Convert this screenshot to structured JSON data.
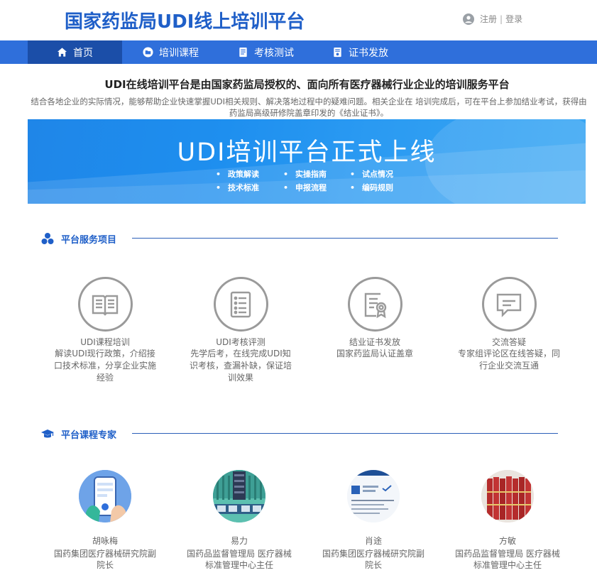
{
  "header": {
    "site_title": "国家药监局UDI线上培训平台",
    "register": "注册",
    "separator": "|",
    "login": "登录"
  },
  "nav": {
    "items": [
      {
        "label": "首页",
        "icon": "home-icon"
      },
      {
        "label": "培训课程",
        "icon": "folder-icon"
      },
      {
        "label": "考核测试",
        "icon": "document-icon"
      },
      {
        "label": "证书发放",
        "icon": "certificate-icon"
      }
    ]
  },
  "intro": {
    "title": "UDI在线培训平台是由国家药监局授权的、面向所有医疗器械行业企业的培训服务平台",
    "desc": "结合各地企业的实际情况，能够帮助企业快速掌握UDI相关规则、解决落地过程中的疑难问题。相关企业在 培训完成后，可在平台上参加结业考试，获得由药监局高级研修院盖章印发的《结业证书》。"
  },
  "banner": {
    "title": "UDI培训平台正式上线",
    "points": [
      "政策解读",
      "实操指南",
      "试点情况",
      "技术标准",
      "申报流程",
      "编码规则"
    ]
  },
  "services_section": {
    "title": "平台服务项目",
    "items": [
      {
        "name": "UDI课程培训",
        "desc": "解读UDI现行政策，介绍接口技术标准，分享企业实施经验",
        "icon": "open-book-icon"
      },
      {
        "name": "UDI考核评测",
        "desc": "先学后考，在线完成UDI知识考核，查漏补缺，保证培训效果",
        "icon": "checklist-icon"
      },
      {
        "name": "结业证书发放",
        "desc": "国家药监局认证盖章",
        "icon": "certificate-badge-icon"
      },
      {
        "name": "交流答疑",
        "desc": "专家组评论区在线答疑，同行企业交流互通",
        "icon": "chat-bubble-icon"
      }
    ]
  },
  "experts_section": {
    "title": "平台课程专家",
    "items": [
      {
        "name": "胡咏梅",
        "title": "国药集团医疗器械研究院副院长"
      },
      {
        "name": "易力",
        "title": "国药品监督管理局 医疗器械标准管理中心主任"
      },
      {
        "name": "肖途",
        "title": "国药集团医疗器械研究院副院长"
      },
      {
        "name": "方敏",
        "title": "国药品监督管理局 医疗器械标准管理中心主任"
      }
    ]
  },
  "colors": {
    "brand_blue": "#1f5fc8",
    "nav_blue": "#2f6fdb",
    "nav_active": "#1b4ea8",
    "banner_blue": "#1f86e8"
  }
}
